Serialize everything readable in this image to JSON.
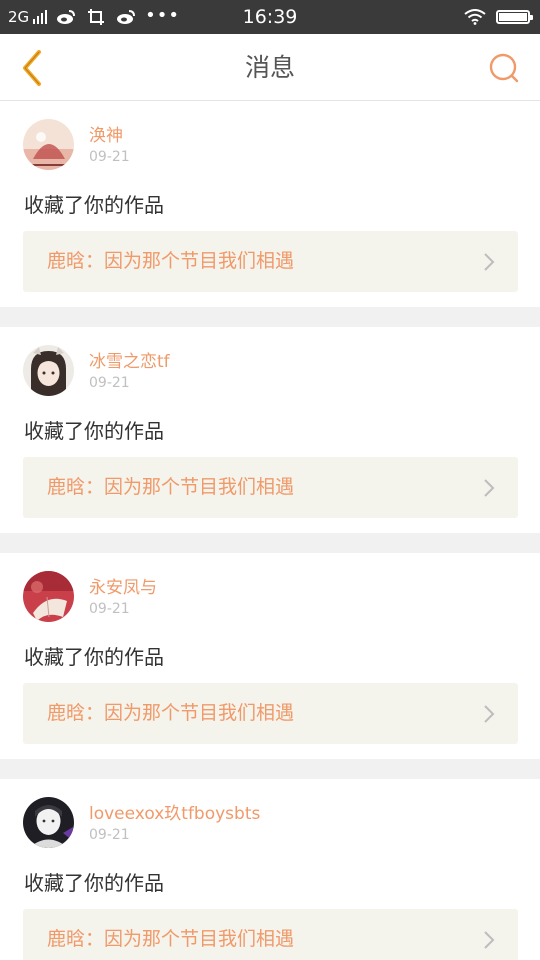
{
  "status_bar": {
    "network": "2G",
    "time": "16:39",
    "icons": [
      "signal-bars-icon",
      "weibo-icon",
      "screenshot-icon",
      "weibo-icon",
      "more-dots-icon",
      "wifi-icon",
      "battery-icon"
    ],
    "more_label": "•••"
  },
  "header": {
    "title": "消息",
    "back_icon": "chevron-left-icon",
    "search_icon": "search-icon",
    "accent_color": "#f5a623"
  },
  "colors": {
    "username": "#f09a6a",
    "work_title": "#f09a6a",
    "date": "#c0c0c0",
    "work_bg": "#f4f3ec"
  },
  "messages": [
    {
      "user": "涣神",
      "date": "09-21",
      "action": "收藏了你的作品",
      "work": "鹿晗：因为那个节目我们相遇"
    },
    {
      "user": "冰雪之恋tf",
      "date": "09-21",
      "action": "收藏了你的作品",
      "work": "鹿晗：因为那个节目我们相遇"
    },
    {
      "user": "永安凤与",
      "date": "09-21",
      "action": "收藏了你的作品",
      "work": "鹿晗：因为那个节目我们相遇"
    },
    {
      "user": "loveexox玖tfboysbts",
      "date": "09-21",
      "action": "收藏了你的作品",
      "work": "鹿晗：因为那个节目我们相遇"
    }
  ]
}
